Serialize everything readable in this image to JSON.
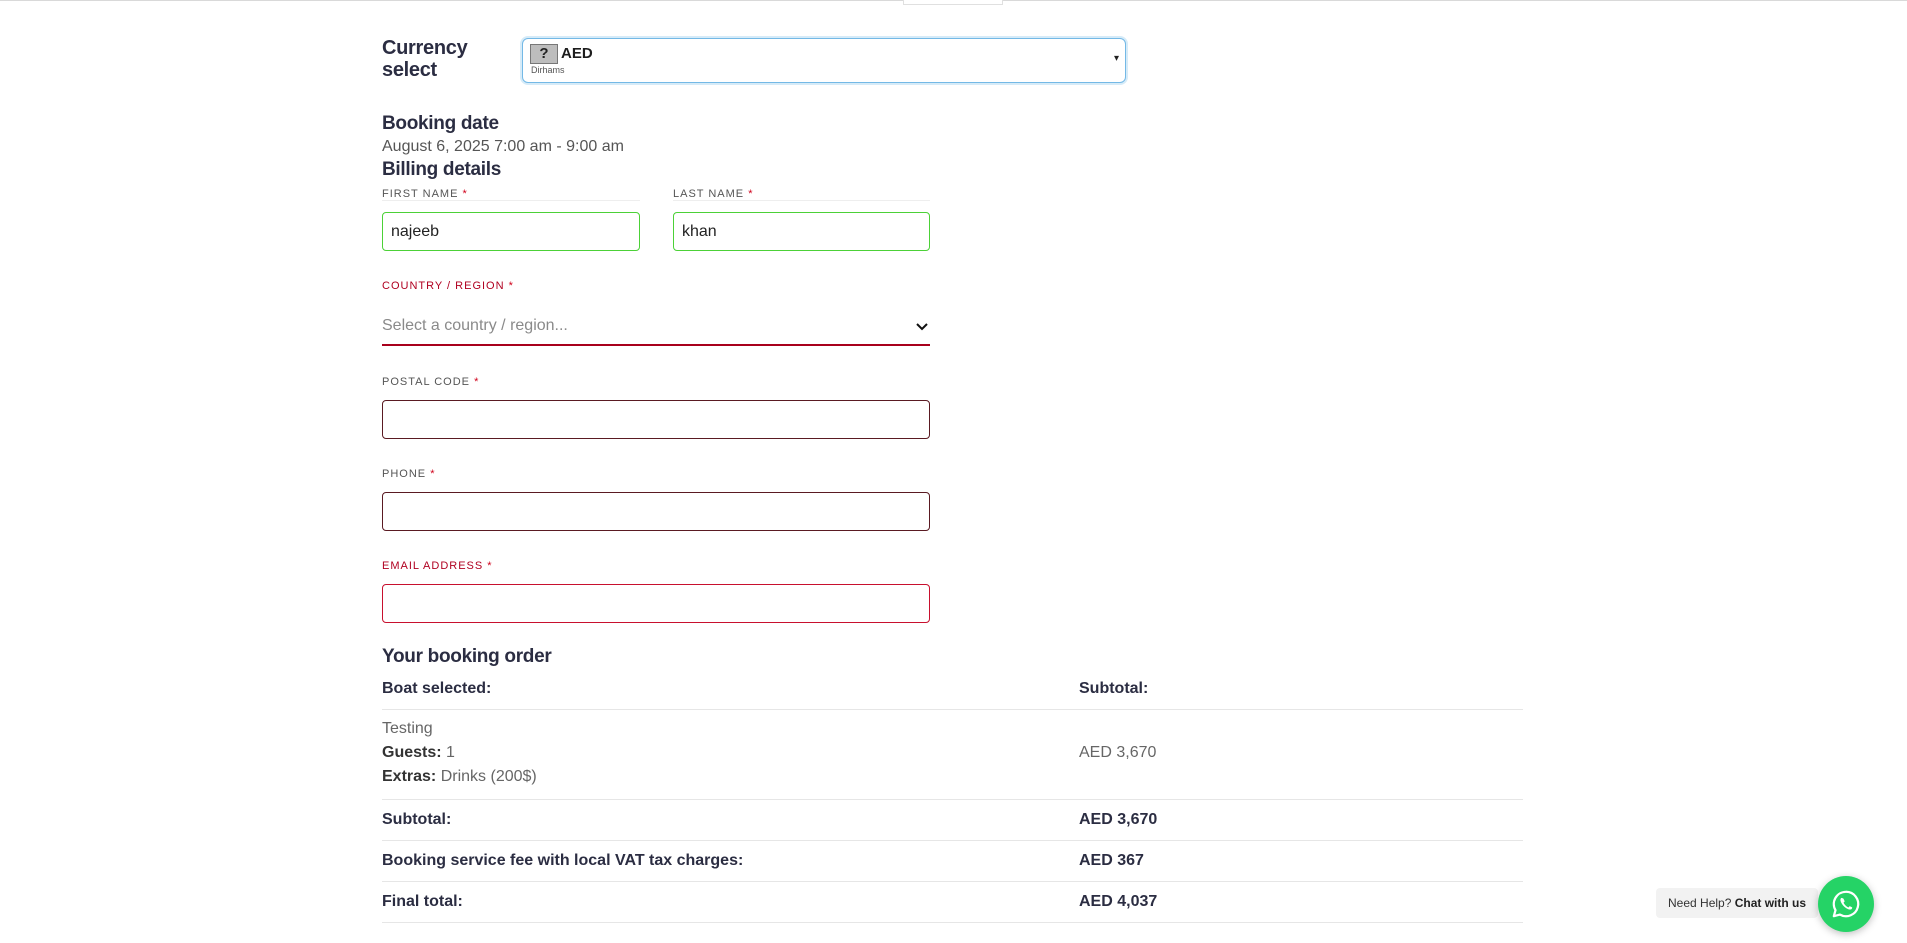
{
  "currency": {
    "label": "Currency select",
    "selected_code": "AED",
    "selected_name": "Dirhams",
    "flag_glyph": "?"
  },
  "booking": {
    "date_title": "Booking date",
    "date_value": "August 6, 2025 7:00 am - 9:00 am"
  },
  "billing": {
    "title": "Billing details",
    "required_mark": "*",
    "first_name": {
      "label": "FIRST NAME",
      "value": "najeeb"
    },
    "last_name": {
      "label": "LAST NAME",
      "value": "khan"
    },
    "country": {
      "label": "COUNTRY / REGION",
      "placeholder": "Select a country / region..."
    },
    "postal_code": {
      "label": "POSTAL CODE",
      "value": ""
    },
    "phone": {
      "label": "PHONE",
      "value": ""
    },
    "email": {
      "label": "EMAIL ADDRESS",
      "value": ""
    }
  },
  "order": {
    "title": "Your booking order",
    "header_left": "Boat selected:",
    "header_right": "Subtotal:",
    "item": {
      "name": "Testing",
      "guests_label": "Guests:",
      "guests_value": "1",
      "extras_label": "Extras:",
      "extras_value": "Drinks (200$)",
      "price": "AED 3,670"
    },
    "subtotal_label": "Subtotal:",
    "subtotal_value": "AED 3,670",
    "fee_label": "Booking service fee with local VAT tax charges:",
    "fee_value": "AED 367",
    "total_label": "Final total:",
    "total_value": "AED 4,037"
  },
  "help": {
    "prefix": "Need Help?",
    "link": "Chat with us"
  },
  "colors": {
    "valid_border": "#4cd137",
    "error": "#c8102e",
    "whatsapp": "#25d366"
  }
}
